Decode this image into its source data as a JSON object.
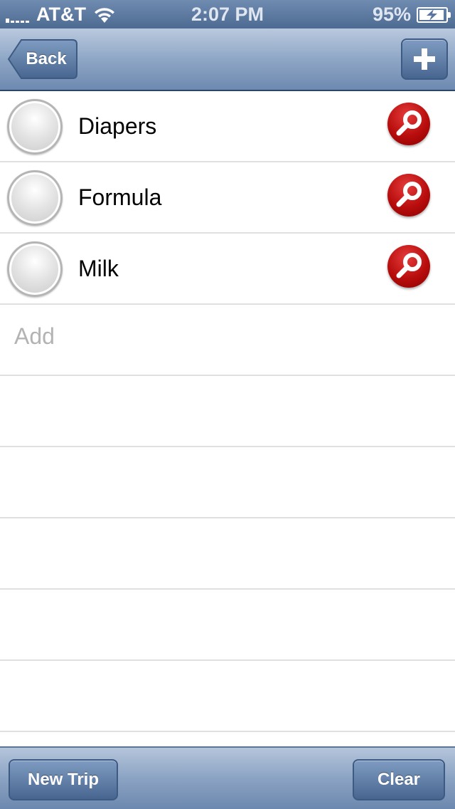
{
  "status_bar": {
    "carrier": "AT&T",
    "time": "2:07 PM",
    "battery_percent": "95%",
    "battery_level": 0.95,
    "icons": [
      "signal-icon",
      "wifi-icon",
      "battery-charging-icon"
    ]
  },
  "nav_bar": {
    "back_label": "Back",
    "add_icon": "plus-icon"
  },
  "items": [
    {
      "label": "Diapers",
      "checked": false
    },
    {
      "label": "Formula",
      "checked": false
    },
    {
      "label": "Milk",
      "checked": false
    }
  ],
  "add_row": {
    "placeholder": "Add"
  },
  "toolbar": {
    "new_trip_label": "New Trip",
    "clear_label": "Clear"
  },
  "colors": {
    "nav_gradient_top": "#b9c9de",
    "nav_gradient_bottom": "#6d89b0",
    "search_button": "#b80d0d",
    "separator": "#e0e0e0"
  }
}
